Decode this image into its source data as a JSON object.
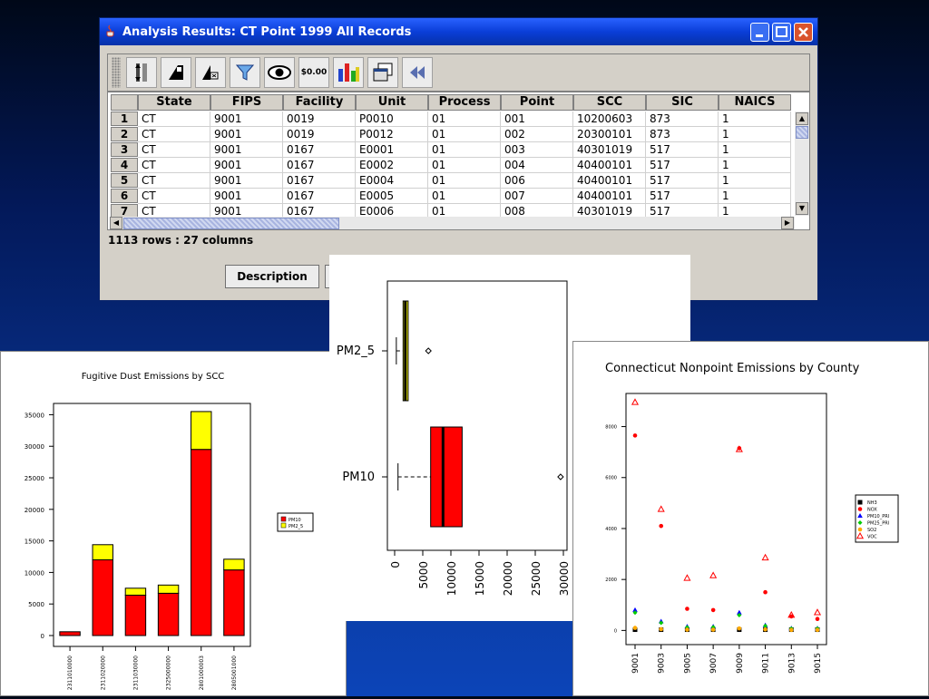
{
  "window": {
    "title": "Analysis Results: CT Point 1999 All Records",
    "toolbar_icons": [
      "sort-icon",
      "format-icon",
      "filter-rows-icon",
      "funnel-icon",
      "eye-icon",
      "money-icon",
      "bar-chart-icon",
      "copy-window-icon",
      "rewind-icon"
    ],
    "money_label": "$0.00",
    "columns": [
      "State",
      "FIPS",
      "Facility",
      "Unit",
      "Process",
      "Point",
      "SCC",
      "SIC",
      "NAICS"
    ],
    "rows": [
      {
        "n": "1",
        "cells": [
          "CT",
          "9001",
          "0019",
          "P0010",
          "01",
          "001",
          "10200603",
          "873",
          "1"
        ]
      },
      {
        "n": "2",
        "cells": [
          "CT",
          "9001",
          "0019",
          "P0012",
          "01",
          "002",
          "20300101",
          "873",
          "1"
        ]
      },
      {
        "n": "3",
        "cells": [
          "CT",
          "9001",
          "0167",
          "E0001",
          "01",
          "003",
          "40301019",
          "517",
          "1"
        ]
      },
      {
        "n": "4",
        "cells": [
          "CT",
          "9001",
          "0167",
          "E0002",
          "01",
          "004",
          "40400101",
          "517",
          "1"
        ]
      },
      {
        "n": "5",
        "cells": [
          "CT",
          "9001",
          "0167",
          "E0004",
          "01",
          "006",
          "40400101",
          "517",
          "1"
        ]
      },
      {
        "n": "6",
        "cells": [
          "CT",
          "9001",
          "0167",
          "E0005",
          "01",
          "007",
          "40400101",
          "517",
          "1"
        ]
      },
      {
        "n": "7",
        "cells": [
          "CT",
          "9001",
          "0167",
          "E0006",
          "01",
          "008",
          "40301019",
          "517",
          "1"
        ]
      }
    ],
    "status": "1113 rows : 27 columns",
    "description_button": "Description"
  },
  "chart_data": [
    {
      "type": "bar",
      "title": "Fugitive Dust Emissions by SCC",
      "categories": [
        "2311010000",
        "2311020000",
        "2311030000",
        "2325000000",
        "2801000003",
        "2805001000"
      ],
      "series": [
        {
          "name": "PM10",
          "color": "#ff0000",
          "values": [
            600,
            12000,
            6400,
            6700,
            29500,
            10400
          ]
        },
        {
          "name": "PM2_5",
          "color": "#ffff00",
          "values": [
            0,
            2400,
            1100,
            1300,
            6000,
            1700
          ]
        }
      ],
      "ylim": [
        0,
        36500
      ],
      "yticks": [
        0,
        5000,
        10000,
        15000,
        20000,
        25000,
        30000,
        35000
      ],
      "legend": "right"
    },
    {
      "type": "boxplot",
      "title": "",
      "categories": [
        "PM2_5",
        "PM10"
      ],
      "boxes": [
        {
          "name": "PM2_5",
          "min": 300,
          "q1": 1500,
          "median": 1900,
          "q3": 2400,
          "max": 2400,
          "outliers": [
            6000
          ],
          "color": "#ffff00"
        },
        {
          "name": "PM10",
          "min": 600,
          "q1": 6400,
          "median": 8600,
          "q3": 12000,
          "max": 12000,
          "outliers": [
            29500
          ],
          "color": "#ff0000"
        }
      ],
      "xlim": [
        0,
        30000
      ],
      "xticks": [
        0,
        5000,
        10000,
        15000,
        20000,
        25000,
        30000
      ]
    },
    {
      "type": "scatter",
      "title": "Connecticut Nonpoint Emissions by County",
      "categories": [
        "9001",
        "9003",
        "9005",
        "9007",
        "9009",
        "9011",
        "9013",
        "9015"
      ],
      "ylim": [
        -200,
        9300
      ],
      "yticks": [
        0,
        2000,
        4000,
        6000,
        8000
      ],
      "series": [
        {
          "name": "NH3",
          "color": "#000000",
          "marker": "square",
          "values": [
            30,
            30,
            30,
            30,
            30,
            30,
            30,
            30
          ]
        },
        {
          "name": "NOX",
          "color": "#ff0000",
          "marker": "circle",
          "values": [
            7650,
            4100,
            850,
            800,
            7150,
            1500,
            550,
            450
          ]
        },
        {
          "name": "PM10_PRI",
          "color": "#0000ff",
          "marker": "triangle-filled",
          "values": [
            800,
            350,
            150,
            150,
            700,
            200,
            80,
            80
          ]
        },
        {
          "name": "PM25_PRI",
          "color": "#00cc00",
          "marker": "diamond",
          "values": [
            700,
            300,
            120,
            130,
            600,
            180,
            70,
            70
          ]
        },
        {
          "name": "SO2",
          "color": "#ffaa00",
          "marker": "circle",
          "values": [
            100,
            50,
            30,
            30,
            80,
            40,
            20,
            20
          ]
        },
        {
          "name": "VOC",
          "color": "#ff0000",
          "marker": "triangle-open",
          "values": [
            8950,
            4750,
            2050,
            2150,
            7100,
            2850,
            600,
            700
          ]
        }
      ],
      "legend": "right"
    }
  ]
}
